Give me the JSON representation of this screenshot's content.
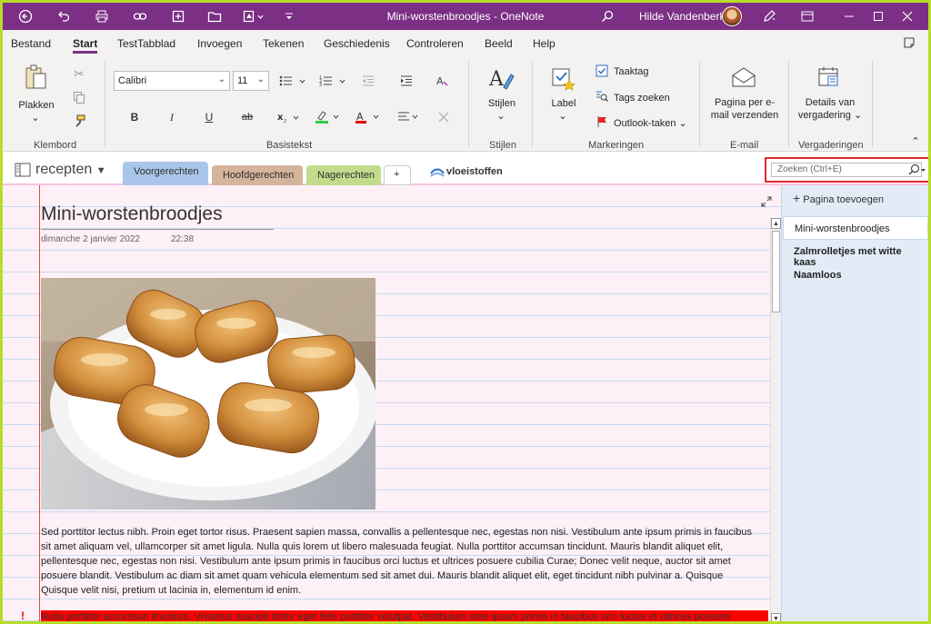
{
  "titlebar": {
    "title": "Mini-worstenbroodjes  -  OneNote",
    "user": "Hilde Vandenberk"
  },
  "menu": [
    "Bestand",
    "Start",
    "TestTabblad",
    "Invoegen",
    "Tekenen",
    "Geschiedenis",
    "Controleren",
    "Beeld",
    "Help"
  ],
  "ribbon": {
    "paste_label": "Plakken",
    "font_name": "Calibri",
    "font_size": "11",
    "bold": "B",
    "italic": "I",
    "underline": "U",
    "strike": "ab",
    "styles_label": "Stijlen",
    "label_label": "Label",
    "taaktag": "Taaktag",
    "tags_zoeken": "Tags zoeken",
    "outlook_taken": "Outlook-taken",
    "email_label_1": "Pagina per e-",
    "email_label_2": "mail verzenden",
    "meeting_label_1": "Details van",
    "meeting_label_2": "vergadering",
    "groups": {
      "klembord": "Klembord",
      "basistekst": "Basistekst",
      "stijlen": "Stijlen",
      "markeringen": "Markeringen",
      "email": "E-mail",
      "vergaderingen": "Vergaderingen"
    }
  },
  "notebook": {
    "name": "recepten",
    "sections": [
      {
        "label": "Voorgerechten",
        "color": "#a9c6ea"
      },
      {
        "label": "Hoofdgerechten",
        "color": "#d5b49c"
      },
      {
        "label": "Nagerechten",
        "color": "#c2dc8c"
      }
    ],
    "add_section": "+",
    "linked": "vloeistoffen",
    "search_placeholder": "Zoeken (Ctrl+E)"
  },
  "page": {
    "title": "Mini-worstenbroodjes",
    "date": "dimanche 2 janvier 2022",
    "time": "22:38",
    "paragraph": [
      "Sed porttitor lectus nibh. Proin eget tortor risus. Praesent sapien massa, convallis a pellentesque nec, egestas non nisi. Vestibulum ante ipsum primis in faucibus",
      "sit amet aliquam vel, ullamcorper sit amet ligula. Nulla quis lorem ut libero malesuada feugiat. Nulla porttitor accumsan tincidunt. Mauris blandit aliquet elit,",
      "pellentesque nec, egestas non nisi. Vestibulum ante ipsum primis in faucibus orci luctus et ultrices posuere cubilia Curae; Donec velit neque, auctor sit amet",
      "posuere blandit. Vestibulum ac diam sit amet quam vehicula elementum sed sit amet dui. Mauris blandit aliquet elit, eget tincidunt nibh pulvinar a. Quisque",
      "Quisque velit nisi, pretium ut lacinia in, elementum id enim."
    ],
    "highlighted": "Nulla porttitor accumsan tincidunt. Vivamus suscipit tortor eget felis porttitor volutpat. Vestibulum ante ipsum primis in faucibus orci luctus et ultrices posuere",
    "mark": "!"
  },
  "pages_pane": {
    "add_page": "Pagina toevoegen",
    "pages": [
      "Mini-worstenbroodjes",
      "Zalmrolletjes met witte kaas",
      "Naamloos"
    ]
  }
}
